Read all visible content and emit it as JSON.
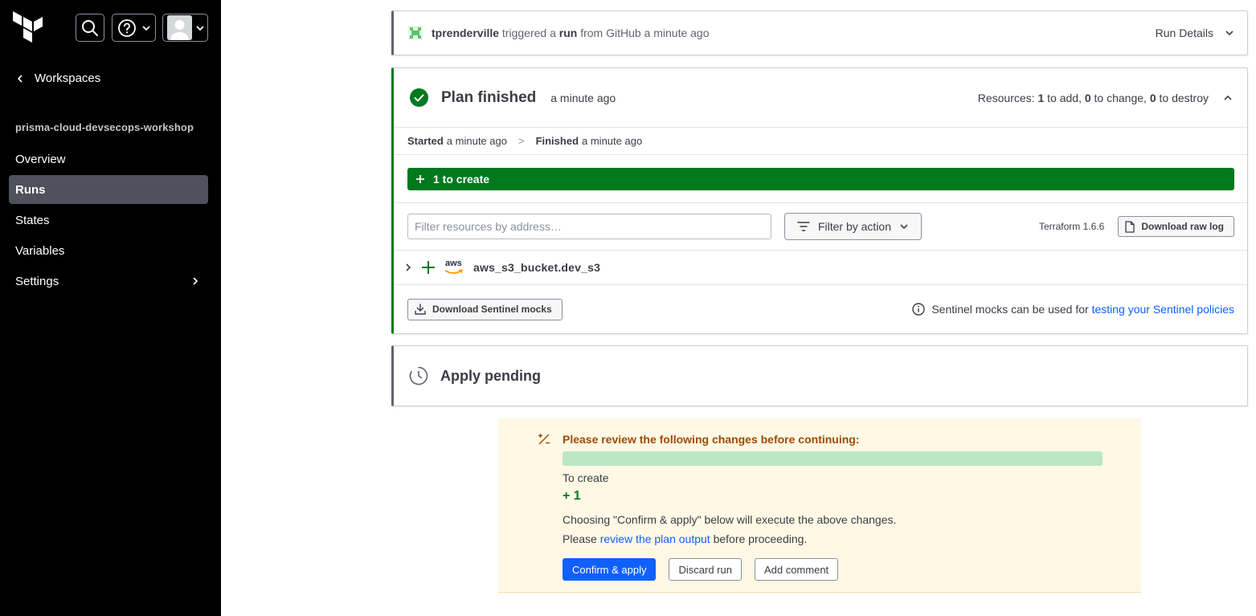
{
  "sidebar": {
    "back_label": "Workspaces",
    "workspace_name": "prisma-cloud-devsecops-workshop",
    "nav": {
      "overview": "Overview",
      "runs": "Runs",
      "states": "States",
      "variables": "Variables",
      "settings": "Settings"
    },
    "active_item": "Runs"
  },
  "run_header": {
    "user": "tprenderville",
    "text_triggered": "triggered a",
    "run_word": "run",
    "text_from": "from GitHub a minute ago",
    "details_label": "Run Details"
  },
  "plan": {
    "title": "Plan finished",
    "time": "a minute ago",
    "resources_prefix": "Resources:",
    "add_count": "1",
    "add_label": "to add,",
    "change_count": "0",
    "change_label": "to change,",
    "destroy_count": "0",
    "destroy_label": "to destroy",
    "started_label": "Started",
    "started_time": "a minute ago",
    "finished_label": "Finished",
    "finished_time": "a minute ago",
    "create_bar_label": "1 to create",
    "filter_placeholder": "Filter resources by address…",
    "filter_action_label": "Filter by action",
    "terraform_version": "Terraform 1.6.6",
    "download_log_label": "Download raw log",
    "resource_provider": "aws",
    "resource_address": "aws_s3_bucket.dev_s3",
    "sentinel_button_label": "Download Sentinel mocks",
    "sentinel_note_prefix": "Sentinel mocks can be used for",
    "sentinel_note_link": "testing your Sentinel policies"
  },
  "apply": {
    "title": "Apply pending"
  },
  "review": {
    "title": "Please review the following changes before continuing:",
    "to_create_label": "To create",
    "create_count": "+ 1",
    "explain": "Choosing \"Confirm & apply\" below will execute the above changes.",
    "please": "Please",
    "plan_link": "review the plan output",
    "before": "before proceeding.",
    "confirm_label": "Confirm & apply",
    "discard_label": "Discard run",
    "comment_label": "Add comment"
  },
  "colors": {
    "sidebar_bg": "#000000",
    "success_green": "#00781e",
    "link_blue": "#1060ff",
    "warning_bg": "#fff8e5",
    "warning_text": "#9e4b00"
  }
}
